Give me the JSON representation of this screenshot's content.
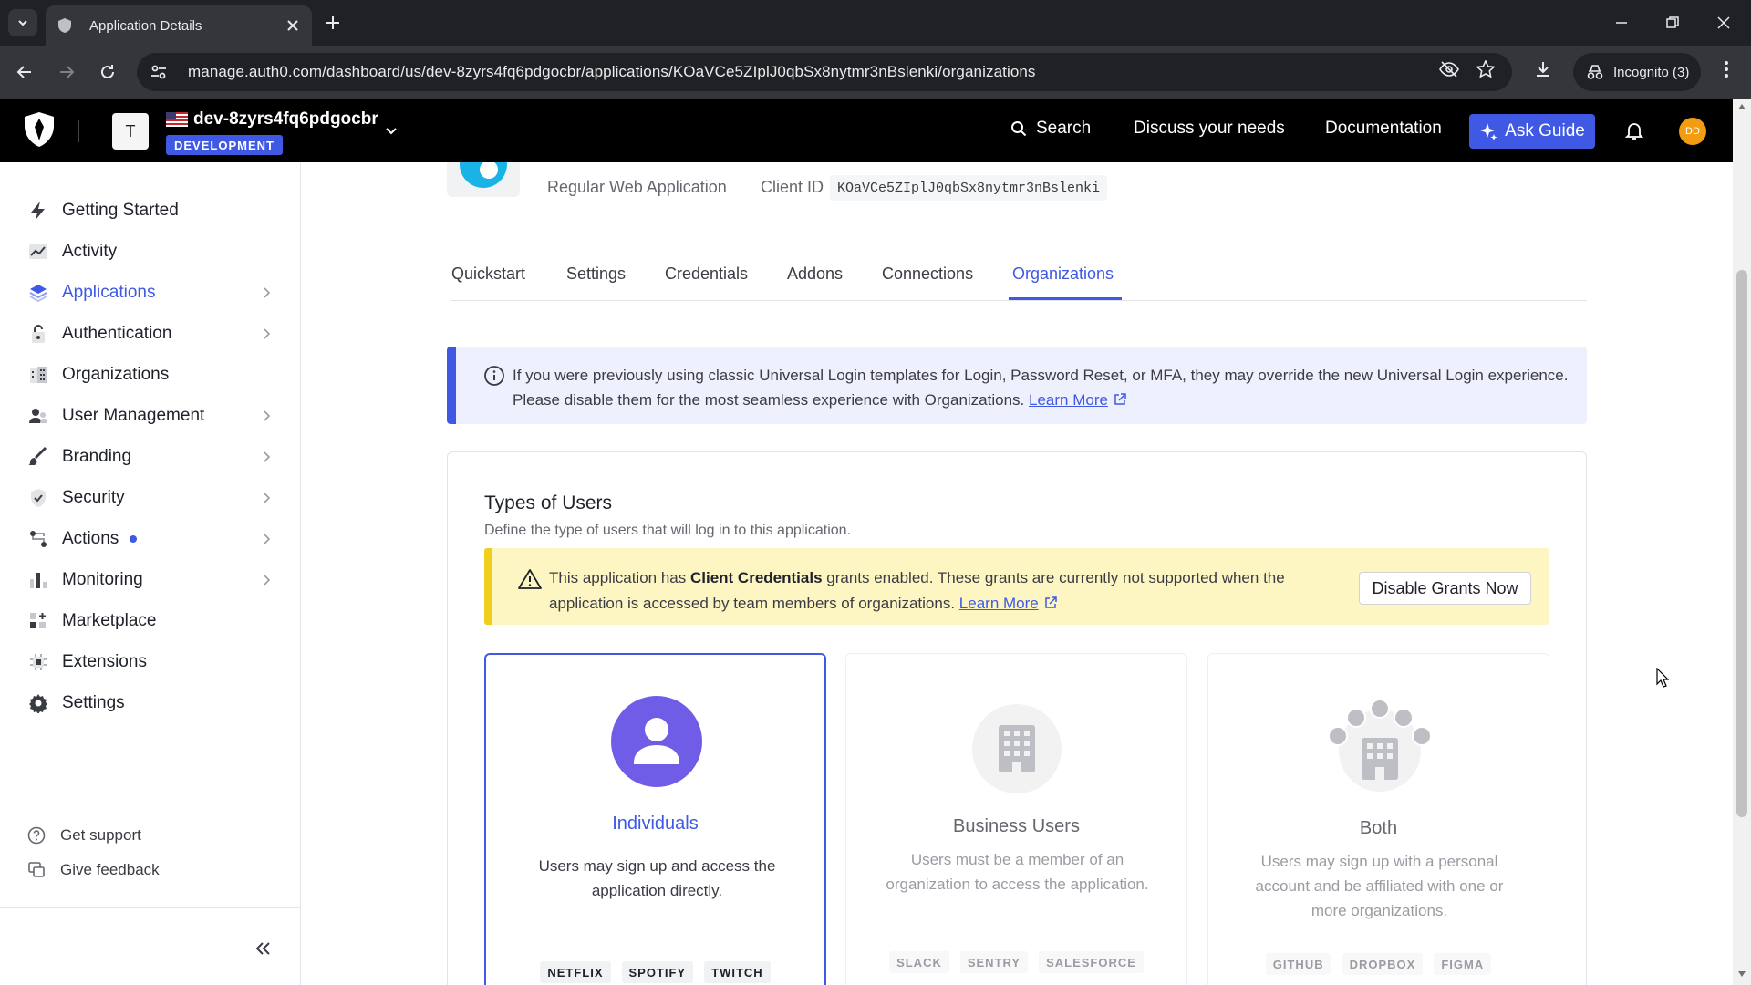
{
  "browser": {
    "tab_title": "Application Details",
    "url": "manage.auth0.com/dashboard/us/dev-8zyrs4fq6pdgocbr/applications/KOaVCe5ZIplJ0qbSx8nytmr3nBslenki/organizations",
    "incognito_label": "Incognito (3)"
  },
  "header": {
    "tenant_avatar": "T",
    "tenant_name": "dev-8zyrs4fq6pdgocbr",
    "environment": "DEVELOPMENT",
    "search_label": "Search",
    "discuss_label": "Discuss your needs",
    "docs_label": "Documentation",
    "ask_guide_label": "Ask Guide",
    "user_initials": "DD"
  },
  "sidebar": {
    "items": [
      {
        "label": "Getting Started"
      },
      {
        "label": "Activity"
      },
      {
        "label": "Applications"
      },
      {
        "label": "Authentication"
      },
      {
        "label": "Organizations"
      },
      {
        "label": "User Management"
      },
      {
        "label": "Branding"
      },
      {
        "label": "Security"
      },
      {
        "label": "Actions"
      },
      {
        "label": "Monitoring"
      },
      {
        "label": "Marketplace"
      },
      {
        "label": "Extensions"
      },
      {
        "label": "Settings"
      }
    ],
    "support_label": "Get support",
    "feedback_label": "Give feedback"
  },
  "app": {
    "type": "Regular Web Application",
    "client_id_label": "Client ID",
    "client_id": "KOaVCe5ZIplJ0qbSx8nytmr3nBslenki"
  },
  "tabs": [
    "Quickstart",
    "Settings",
    "Credentials",
    "Addons",
    "Connections",
    "Organizations"
  ],
  "info_banner": {
    "text": "If you were previously using classic Universal Login templates for Login, Password Reset, or MFA, they may override the new Universal Login experience. Please disable them for the most seamless experience with Organizations.",
    "link": "Learn More"
  },
  "types_section": {
    "title": "Types of Users",
    "subtitle": "Define the type of users that will log in to this application.",
    "warning_pre": "This application has ",
    "warning_bold": "Client Credentials",
    "warning_post": " grants enabled. These grants are currently not supported when the application is accessed by team members of organizations.",
    "warning_link": "Learn More",
    "disable_button": "Disable Grants Now",
    "options": [
      {
        "title": "Individuals",
        "desc": "Users may sign up and access the application directly.",
        "tags": [
          "NETFLIX",
          "SPOTIFY",
          "TWITCH"
        ]
      },
      {
        "title": "Business Users",
        "desc": "Users must be a member of an organization to access the application.",
        "tags": [
          "SLACK",
          "SENTRY",
          "SALESFORCE"
        ]
      },
      {
        "title": "Both",
        "desc": "Users may sign up with a personal account and be affiliated with one or more organizations.",
        "tags": [
          "GITHUB",
          "DROPBOX",
          "FIGMA"
        ]
      }
    ]
  }
}
